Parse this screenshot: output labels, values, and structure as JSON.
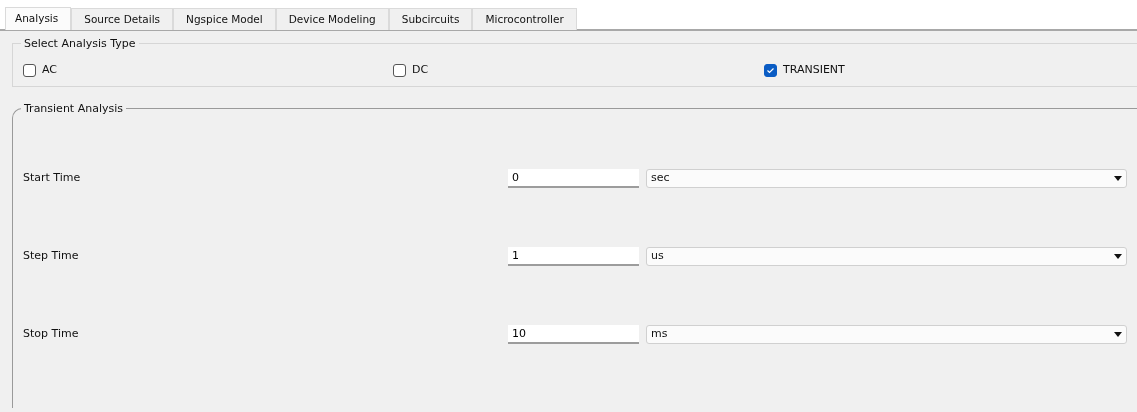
{
  "tabs": [
    {
      "label": "Analysis",
      "selected": true
    },
    {
      "label": "Source Details",
      "selected": false
    },
    {
      "label": "Ngspice Model",
      "selected": false
    },
    {
      "label": "Device Modeling",
      "selected": false
    },
    {
      "label": "Subcircuits",
      "selected": false
    },
    {
      "label": "Microcontroller",
      "selected": false
    }
  ],
  "analysis_type": {
    "title": "Select Analysis Type",
    "options": [
      {
        "label": "AC",
        "checked": false
      },
      {
        "label": "DC",
        "checked": false
      },
      {
        "label": "TRANSIENT",
        "checked": true
      }
    ]
  },
  "transient": {
    "title": "Transient Analysis",
    "rows": [
      {
        "label": "Start Time",
        "value": "0",
        "unit": "sec"
      },
      {
        "label": "Step Time",
        "value": "1",
        "unit": "us"
      },
      {
        "label": "Stop Time",
        "value": "10",
        "unit": "ms"
      }
    ]
  }
}
